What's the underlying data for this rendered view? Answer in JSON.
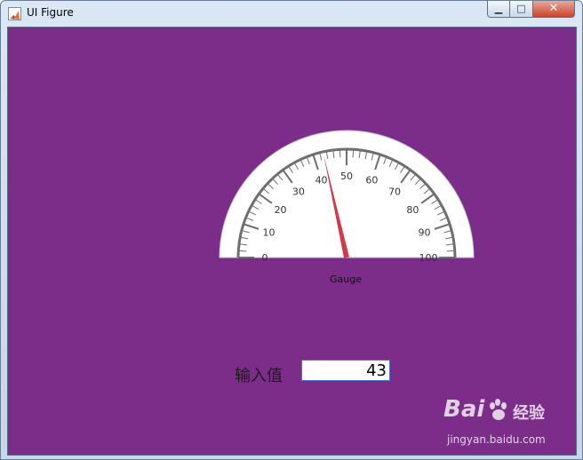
{
  "window": {
    "title": "UI Figure",
    "minimize_glyph": "▁",
    "maximize_glyph": "□",
    "close_glyph": "✕"
  },
  "colors": {
    "background": "#7c2d8a",
    "needle": "#d23a45",
    "gauge_face": "#ffffff",
    "gauge_scale": "#6e6e6e"
  },
  "gauge": {
    "label": "Gauge",
    "min": 0,
    "max": 100,
    "value": 43,
    "tick_labels": [
      "0",
      "10",
      "20",
      "30",
      "40",
      "50",
      "60",
      "70",
      "80",
      "90",
      "100"
    ]
  },
  "edit_field": {
    "label": "输入值",
    "value": "43"
  },
  "watermark": {
    "brand": "Bai",
    "product": "经验",
    "url": "jingyan.baidu.com",
    "icon": "paw-icon"
  }
}
